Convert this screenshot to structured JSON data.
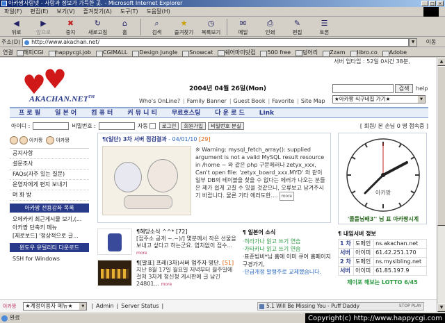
{
  "window": {
    "title": "아카짱사랑넷 - 사랑과 정보가 가득한 곳. - Microsoft Internet Explorer",
    "controls": [
      "_",
      "□",
      "×"
    ]
  },
  "menubar": [
    "파일(F)",
    "편집(E)",
    "보기(V)",
    "즐겨찾기(A)",
    "도구(T)",
    "도움말(H)"
  ],
  "toolbar": {
    "back": "뒤로",
    "forward": "앞으로",
    "stop": "중지",
    "refresh": "새로고침",
    "home": "홈",
    "search": "검색",
    "favorites": "즐겨찾기",
    "history": "목록보기",
    "mail": "메일",
    "print": "인쇄",
    "edit": "편집",
    "discuss": "토론"
  },
  "address": {
    "label": "주소(D)",
    "url": "http://www.akachan.net/",
    "go": "이동"
  },
  "links": {
    "label": "연결",
    "items": [
      "해피CGI",
      "happycgi.job",
      "CGIMALL",
      "Design Jungle",
      "Snowcat",
      "쉐어마미닷컴",
      "500 free",
      "덩어리",
      "Zzam",
      "libro.co",
      "Adobe"
    ]
  },
  "site": {
    "logo_text": "AKACHAN.NET",
    "logo_tm": "TM",
    "date": "2004년 04월 26일(Mon)",
    "toplinks": [
      "Who's OnLine?",
      "Family Banner",
      "Guest Book",
      "Favorite",
      "Site Map"
    ],
    "server_uptime": "서버 업타임 : 52일 0시간 38분,",
    "search_button": "검색",
    "help": "help",
    "favorites_select": "★아카짱 식구네집 가기★",
    "nav": [
      "프 로 필",
      "일 본 어",
      "컴 퓨 터",
      "커 뮤 니 티",
      "무료호스팅",
      "다 운 로 드",
      "Link"
    ],
    "login": {
      "id_label": "아이디 :",
      "pw_label": "비밀번호 :",
      "auto_label": "자동",
      "login_btn": "로그인",
      "join_btn": "회원가입",
      "find_btn": "비밀번호 분실",
      "stats": "[ 회원/ 본 손님 0 명 접속중 ]"
    }
  },
  "left": {
    "avatar_labels": [
      "아카짱",
      "아카짱"
    ],
    "menu": [
      "공지사항",
      "설문조사",
      "FAQs(자주 있는 질문)",
      "운영자에게 편지 보내기",
      "며 화 방"
    ],
    "box1": "아카짱 전용강좌 목록",
    "menu2": [
      "오에카키 최근게시물 보기,(...",
      "아카짱 단축키 메뉴",
      "[제로보드] '정상적으로 글..."
    ],
    "box2": "윈도우 유틸리티 다운로드",
    "menu3": [
      "SSH for Windows"
    ]
  },
  "post": {
    "title": "¶(일단) 3차 서버 점검결과",
    "date": "- 04/01/10",
    "count": "[29]",
    "body": "※ Warning: mysql_fetch_array(): supplied argument is not a valid MySQL result resource in /home ~ 와 같은 php 구문에러나 zetyx_xxx, Can't open file: 'zetyx_board_xxx.MYD' 와 같이 일부 DB의 테이블을 찾을 수 없다는 에러가 나오는 분들은 제가 쉽게 고칠 수 있을 것같으니, 오류보고 남겨주시기 바랍니다. 물론 기타 에러도한....",
    "more": "more"
  },
  "news": [
    {
      "title": "¶혜당소식 ^^* [72]",
      "body": "[접주소 공개 ~.~)/] 몇분께서 작은 선물을 보내고 싶다고 하는군요. 염치없이 접수...",
      "more": "more"
    },
    {
      "title": "¶[발표] 프레(3차)서버 업주자 명단.",
      "count": "[51]",
      "body": "지난 8월 17일 월요일 저녁부터 월주일에 걸쳐 3차계 청신청 게시판에 글 남긴 24801...",
      "more": "more"
    }
  ],
  "side_news": {
    "title": "¶ 일본어 소식",
    "items": [
      "·히라가나 읽고 쓰기 연습",
      "·가타카나 읽고 쓰기 연습",
      "·표준빔비*님 홈에 이미 큐어 홈페이지 구경가기,",
      "·단급개정 발행주로 교체했습니다."
    ]
  },
  "clock": {
    "caption": "'졸틀님배3'' 님 표 아카짱시계",
    "label": "아카짱"
  },
  "server_info": {
    "title": "¶ 내임서버 정보",
    "rows": [
      {
        "k": "1 차",
        "l": "도메인",
        "v": "ns.akachan.net"
      },
      {
        "k": "서버",
        "l": "아이피",
        "v": "61.42.251.170"
      },
      {
        "k": "2 차",
        "l": "도메인",
        "v": "ns.mysibling.net"
      },
      {
        "k": "서버",
        "l": "아이피",
        "v": "61.85.197.9"
      }
    ]
  },
  "lotto": "제이포 해보는 LOTTO 6/45",
  "bottom": {
    "ac_link": "아카짱",
    "select": "★계정이용자 메뉴★",
    "links": [
      "Admin",
      "Server Status"
    ],
    "player": "5.1 Will Be Missing You - Puff Daddy",
    "player_ctl": "STOP PLAY"
  },
  "status": {
    "text": "완료",
    "copyright": "Copyright(c) http://www.happycgi.com"
  }
}
